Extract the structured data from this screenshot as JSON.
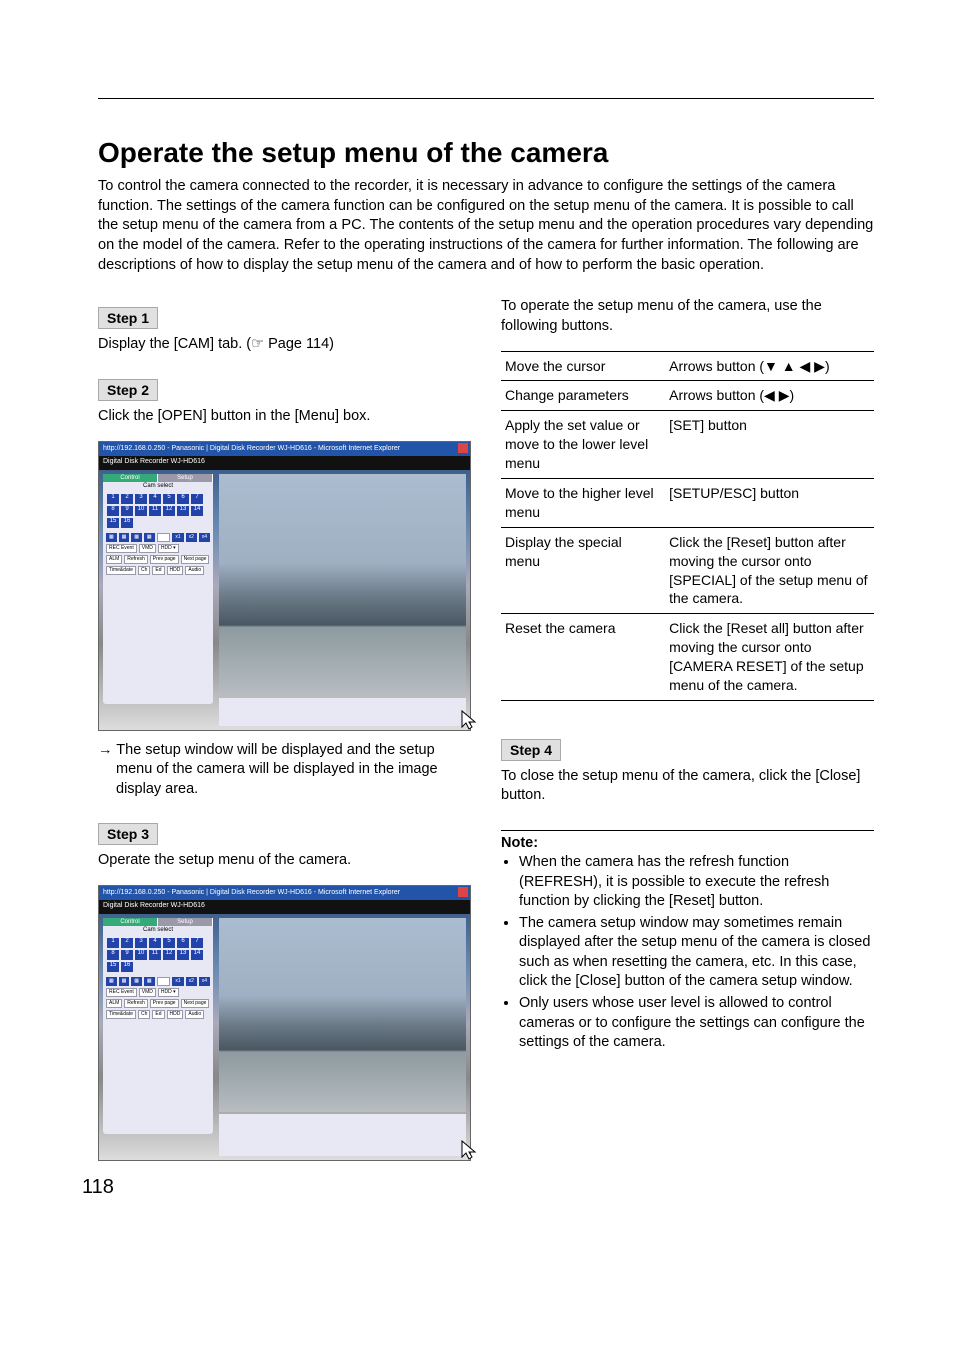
{
  "title": "Operate the setup menu of the camera",
  "intro": "To control the camera connected to the recorder, it is necessary in advance to configure the settings of the camera function. The settings of the camera function can be configured on the setup menu of the camera. It is possible to call the setup menu of the camera from a PC. The contents of the setup menu and the operation procedures vary depending on the model of the camera. Refer to the operating instructions of the camera for further information. The following are descriptions of how to display the setup menu of the camera and of how to perform the basic operation.",
  "left": {
    "step1_label": "Step 1",
    "step1_body": "Display the [CAM] tab. (☞ Page 114)",
    "step2_label": "Step 2",
    "step2_body": "Click the [OPEN] button in the [Menu] box.",
    "arrow_body": "→ The setup window will be displayed and the setup menu of the camera will be displayed in the image display area.",
    "step3_label": "Step 3",
    "step3_body": "Operate the setup menu of the camera."
  },
  "right": {
    "lead": "To operate the setup menu of the camera, use the following buttons.",
    "table": [
      {
        "k": "Move the cursor",
        "v": "Arrows button (▼ ▲  ◀ ▶)"
      },
      {
        "k": "Change parameters",
        "v": "Arrows button (◀ ▶)"
      },
      {
        "k": "Apply the set value or move to the lower level menu",
        "v": "[SET] button"
      },
      {
        "k": "Move to the higher level menu",
        "v": "[SETUP/ESC] button"
      },
      {
        "k": "Display the special menu",
        "v": "Click the [Reset] button after moving the cursor onto [SPECIAL] of the setup menu of the camera."
      },
      {
        "k": "Reset the camera",
        "v": "Click the [Reset all] button after moving the cursor onto [CAMERA RESET] of the setup menu of the camera."
      }
    ],
    "step4_label": "Step 4",
    "step4_body": "To close the setup menu of the camera, click the [Close] button.",
    "note_head": "Note:",
    "notes": [
      "When the camera has the refresh function (REFRESH), it is possible to execute the refresh function by clicking the [Reset] button.",
      "The camera setup window may sometimes remain displayed after the setup menu of the camera is closed such as when resetting the camera, etc. In this case, click the [Close] button of the camera setup window.",
      "Only users whose user level is allowed to control cameras or to configure the settings can configure the settings of the camera."
    ]
  },
  "screenshots": {
    "title_bar": "http://192.168.0.250 - Panasonic | Digital Disk Recorder WJ-HD616 - Microsoft Internet Explorer",
    "header": "Digital Disk Recorder WJ-HD616",
    "tab_control": "Control",
    "tab_setup": "Setup",
    "label_camselect": "Cam select"
  },
  "page_num": "118"
}
